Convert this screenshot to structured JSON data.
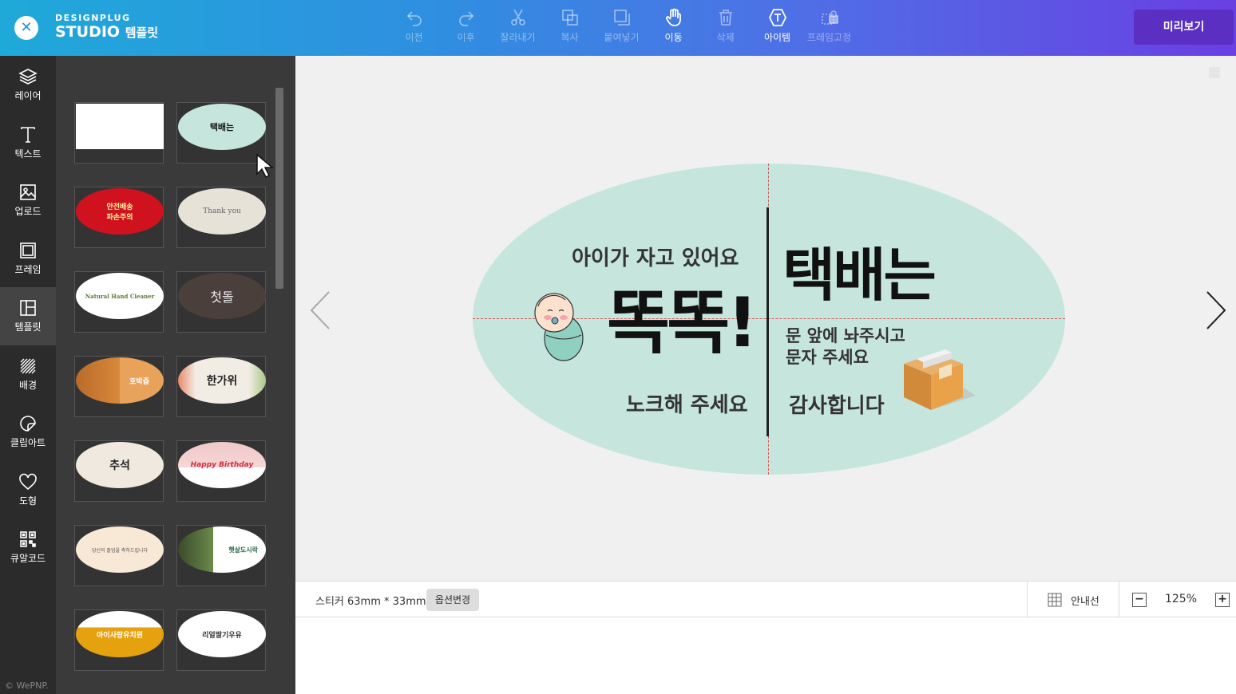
{
  "header": {
    "logo_top": "DESIGNPLUG",
    "logo_main": "STUDIO",
    "logo_sub": "템플릿",
    "close_label": "✕",
    "toolbar": [
      {
        "id": "undo",
        "label": "이전",
        "icon": "undo-icon",
        "active": false
      },
      {
        "id": "redo",
        "label": "이후",
        "icon": "redo-icon",
        "active": false
      },
      {
        "id": "cut",
        "label": "잘라내기",
        "icon": "scissors-icon",
        "active": false
      },
      {
        "id": "copy",
        "label": "복사",
        "icon": "copy-icon",
        "active": false
      },
      {
        "id": "paste",
        "label": "붙여넣기",
        "icon": "paste-icon",
        "active": false
      },
      {
        "id": "move",
        "label": "이동",
        "icon": "hand-icon",
        "active": true
      },
      {
        "id": "delete",
        "label": "삭제",
        "icon": "trash-icon",
        "active": false
      },
      {
        "id": "item",
        "label": "아이템",
        "icon": "item-icon",
        "active": true
      },
      {
        "id": "lock",
        "label": "프레임고정",
        "icon": "lock-icon",
        "active": false
      }
    ],
    "preview_label": "미리보기"
  },
  "leftnav": {
    "items": [
      {
        "label": "레이어",
        "icon": "layers-icon"
      },
      {
        "label": "텍스트",
        "icon": "text-icon"
      },
      {
        "label": "업로드",
        "icon": "image-upload-icon"
      },
      {
        "label": "프레임",
        "icon": "frame-icon"
      },
      {
        "label": "템플릿",
        "icon": "template-icon",
        "active": true
      },
      {
        "label": "배경",
        "icon": "background-icon"
      },
      {
        "label": "클립아트",
        "icon": "clipart-icon"
      },
      {
        "label": "도형",
        "icon": "heart-icon"
      },
      {
        "label": "큐알코드",
        "icon": "qrcode-icon"
      }
    ],
    "copyright": "© WePNP."
  },
  "panel": {
    "templates": [
      {
        "name": "blank",
        "text": "",
        "bg": "#ffffff"
      },
      {
        "name": "knock-delivery",
        "text": "택배는",
        "bg": "#c6e6dd"
      },
      {
        "name": "safe-delivery",
        "text": "안전배송\n파손주의",
        "bg": "#d0121e"
      },
      {
        "name": "thank-you",
        "text": "Thank you",
        "bg": "#e7e2d8"
      },
      {
        "name": "hand-cleaner",
        "text": "Natural Hand Cleaner",
        "bg": "#ffffff"
      },
      {
        "name": "first-birthday",
        "text": "첫돌",
        "bg": "#4a3f3a"
      },
      {
        "name": "pumpkin",
        "text": "호박즙",
        "bg": "#e9a25a"
      },
      {
        "name": "chuseok-1",
        "text": "한가위",
        "bg": "#f2ede4"
      },
      {
        "name": "chuseok-2",
        "text": "추석",
        "bg": "#efe9df"
      },
      {
        "name": "birthday",
        "text": "Happy Birthday",
        "bg": "#f6d6d6"
      },
      {
        "name": "graduation",
        "text": "당신의 졸업을 축하드립니다",
        "bg": "#f8e8d6"
      },
      {
        "name": "lunchbox",
        "text": "햇살도시락",
        "bg": "#ffffff"
      },
      {
        "name": "kindergarten",
        "text": "아이사랑유치원",
        "bg": "#e6a20e"
      },
      {
        "name": "strawberry-milk",
        "text": "리얼딸기우유",
        "bg": "#ffffff"
      }
    ]
  },
  "canvas": {
    "sticker": {
      "line1": "아이가 자고 있어요",
      "big_left": "똑똑!",
      "line3": "노크해 주세요",
      "big_right": "택배는",
      "right_l1": "문 앞에 놔주시고",
      "right_l2": "문자 주세요",
      "right_l3": "감사합니다",
      "bg_color": "#c6e6dd"
    }
  },
  "bottombar": {
    "size_label": "스티커 63mm * 33mm",
    "option_label": "옵션변경",
    "guide_label": "안내선",
    "zoom_minus": "−",
    "zoom_value": "125%",
    "zoom_plus": "+"
  }
}
